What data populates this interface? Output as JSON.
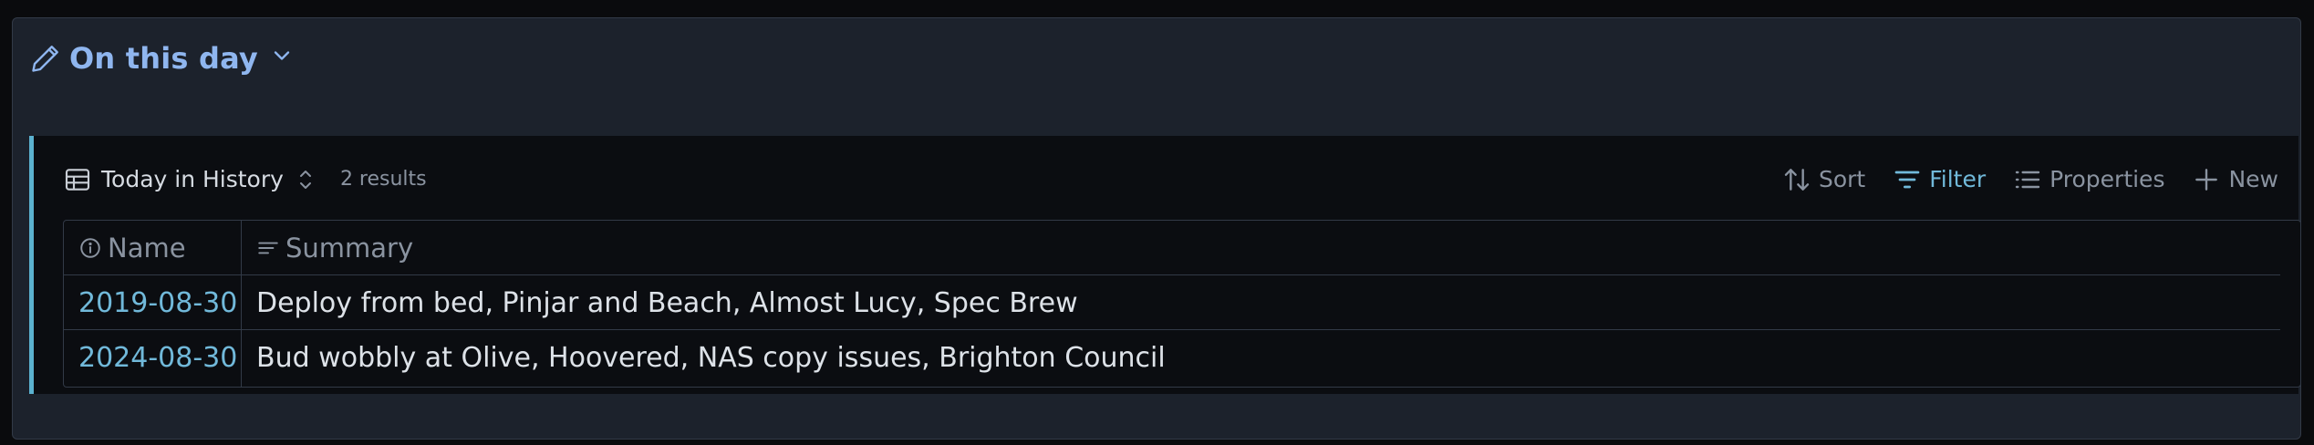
{
  "header": {
    "title": "On this day"
  },
  "view": {
    "name": "Today in History",
    "count": "2 results"
  },
  "toolbar": {
    "sort_label": "Sort",
    "filter_label": "Filter",
    "properties_label": "Properties",
    "new_label": "New"
  },
  "table": {
    "columns": [
      "Name",
      "Summary"
    ],
    "rows": [
      {
        "name": "2019-08-30",
        "summary": "Deploy from bed, Pinjar and Beach, Almost Lucy, Spec Brew"
      },
      {
        "name": "2024-08-30",
        "summary": "Bud wobbly at Olive, Hoovered, NAS copy issues, Brighton Council"
      }
    ]
  },
  "colors": {
    "accent": "#71b9da",
    "title": "#8fb6ef",
    "panel_border": "#5bb1cf",
    "background": "#0a0b0d",
    "card": "#1c222c"
  },
  "icons": {
    "title_icon": "pencil-icon",
    "title_toggle": "chevron-down-icon",
    "view_icon": "table-icon",
    "view_switch": "chevron-up-down-icon",
    "sort": "sort-icon",
    "filter": "filter-icon",
    "properties": "list-icon",
    "new": "plus-icon",
    "name_column": "info-icon",
    "summary_column": "text-lines-icon"
  }
}
